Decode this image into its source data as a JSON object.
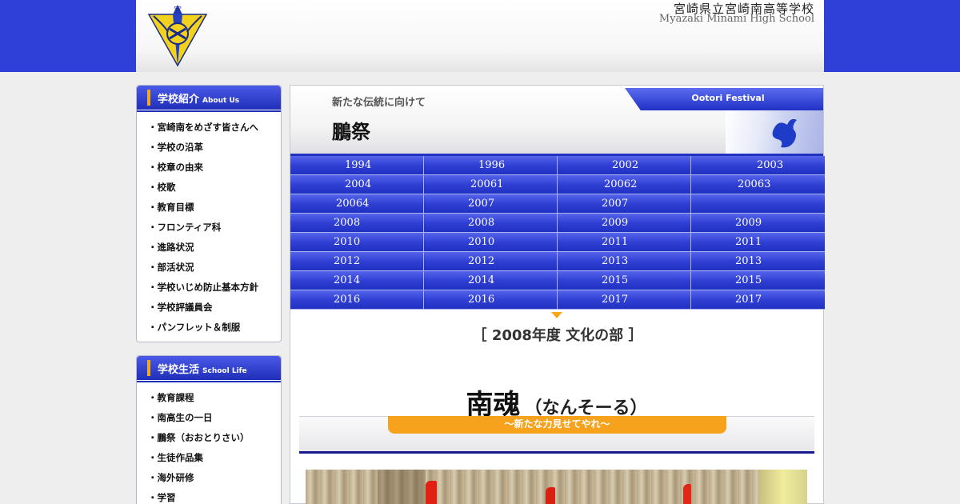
{
  "header": {
    "school_name_jp": "宮崎県立宮崎南高等学校",
    "school_name_en": "Myazaki Minami High School"
  },
  "sidebar": {
    "about": {
      "title_jp": "学校紹介",
      "title_en": "About Us",
      "items": [
        "宮崎南をめざす皆さんへ",
        "学校の沿革",
        "校章の由来",
        "校歌",
        "教育目標",
        "フロンティア科",
        "進路状況",
        "部活状況",
        "学校いじめ防止基本方針",
        "学校評議員会",
        "パンフレット＆制服"
      ]
    },
    "school_life": {
      "title_jp": "学校生活",
      "title_en": "School Life",
      "items": [
        "教育課程",
        "南高生の一日",
        "鵬祭（おおとりさい）",
        "生徒作品集",
        "海外研修",
        "学習"
      ]
    }
  },
  "main": {
    "subtitle": "新たな伝統に向けて",
    "title": "鵬祭",
    "tab_label": "Ootori Festival",
    "years": [
      [
        "1994",
        "1996",
        "2002",
        "2003"
      ],
      [
        "2004",
        "20061",
        "20062",
        "20063"
      ],
      [
        "20064",
        "2007",
        "2007",
        ""
      ],
      [
        "2008",
        "2008",
        "2009",
        "2009"
      ],
      [
        "2010",
        "2010",
        "2011",
        "2011"
      ],
      [
        "2012",
        "2012",
        "2013",
        "2013"
      ],
      [
        "2014",
        "2014",
        "2015",
        "2015"
      ],
      [
        "2016",
        "2016",
        "2017",
        "2017"
      ]
    ],
    "section_title": "［ 2008年度 文化の部 ］",
    "festival_theme": "南魂",
    "festival_reading": "（なんそーる）",
    "festival_slogan": "～新たな力見せてやれ～"
  },
  "colors": {
    "brand_blue": "#2f40d8",
    "accent_orange": "#f6a917"
  }
}
